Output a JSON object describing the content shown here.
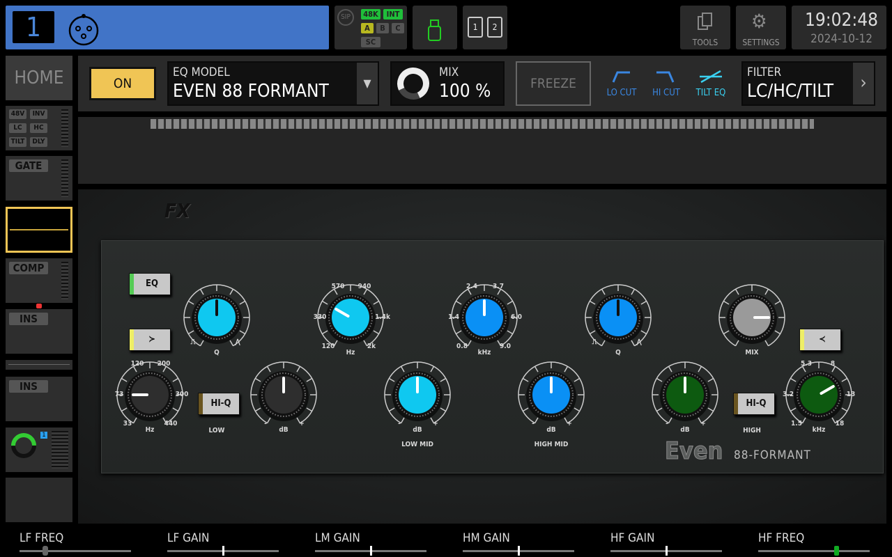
{
  "header": {
    "channel_number": "1",
    "channel_icon": "xlr-input-icon",
    "sip": "SIP",
    "rate": "48K",
    "clock": "INT",
    "buses": [
      "A",
      "B",
      "C"
    ],
    "sc": "SC",
    "usb_icon": "usb-icon",
    "sd_slots": [
      "1",
      "2"
    ],
    "tools": "TOOLS",
    "settings": "SETTINGS",
    "time": "19:02:48",
    "date": "2024-10-12"
  },
  "sidebar": {
    "home": "HOME",
    "input_tags": [
      "48V",
      "INV",
      "LC",
      "HC",
      "TILT",
      "DLY"
    ],
    "gate": "GATE",
    "comp": "COMP",
    "ins1": "INS",
    "ins2": "INS",
    "send_number": "1"
  },
  "toolbar": {
    "on": "ON",
    "eq_model_label": "EQ MODEL",
    "eq_model": "EVEN 88 FORMANT",
    "mix_label": "MIX",
    "mix_value": "100 %",
    "mix_level": 1.0,
    "freeze": "FREEZE",
    "lo_cut": "LO CUT",
    "hi_cut": "HI CUT",
    "tilt_eq": "TILT EQ",
    "filter_label": "FILTER",
    "filter_value": "LC/HC/TILT"
  },
  "plugin": {
    "logo": "FX",
    "brand": "Even",
    "model": "88-FORMANT",
    "eq_button": "EQ",
    "hiq": "HI-Q",
    "low": "LOW",
    "low_mid": "LOW MID",
    "high_mid": "HIGH MID",
    "high": "HIGH",
    "mix": "MIX",
    "knobs": [
      {
        "id": "lm-q",
        "color": "#0fc8f0",
        "position": 0.5,
        "pointer": "#111",
        "unit": "Q",
        "scale": [],
        "q": true
      },
      {
        "id": "lm-freq",
        "color": "#0fc8f0",
        "position": 0.3,
        "pointer": "#fff",
        "unit": "Hz",
        "scale": [
          "570",
          "940",
          "330",
          "1.4k",
          "120",
          "2k"
        ]
      },
      {
        "id": "hm-freq",
        "color": "#0a90f5",
        "position": 0.5,
        "pointer": "#fff",
        "unit": "kHz",
        "scale": [
          "2.4",
          "3.7",
          "1.4",
          "6.0",
          "0.8",
          "9.0"
        ]
      },
      {
        "id": "hm-q",
        "color": "#0a90f5",
        "position": 0.5,
        "pointer": "#111",
        "unit": "Q",
        "scale": [],
        "q": true
      },
      {
        "id": "mix",
        "color": "#9a9a9a",
        "position": 0.8,
        "pointer": "#fff",
        "unit": "",
        "scale": []
      },
      {
        "id": "lf-freq",
        "color": "#2e2e2e",
        "position": 0.2,
        "pointer": "#fff",
        "unit": "Hz",
        "scale": [
          "120",
          "200",
          "73",
          "300",
          "33",
          "440"
        ]
      },
      {
        "id": "lf-gain",
        "color": "#2e2e2e",
        "position": 0.5,
        "pointer": "#fff",
        "unit": "dB",
        "scale": [],
        "pm": true
      },
      {
        "id": "lm-gain",
        "color": "#0fc8f0",
        "position": 0.5,
        "pointer": "#fff",
        "unit": "dB",
        "scale": [],
        "pm": true
      },
      {
        "id": "hm-gain",
        "color": "#0a90f5",
        "position": 0.5,
        "pointer": "#fff",
        "unit": "dB",
        "scale": [],
        "pm": true
      },
      {
        "id": "hf-gain",
        "color": "#0d5a10",
        "position": 0.5,
        "pointer": "#fff",
        "unit": "dB",
        "scale": [],
        "pm": true
      },
      {
        "id": "hf-freq",
        "color": "#0d5a10",
        "position": 0.7,
        "pointer": "#fff",
        "unit": "kHz",
        "scale": [
          "5.3",
          "8",
          "3.2",
          "13",
          "1.5",
          "18"
        ]
      }
    ]
  },
  "params": [
    {
      "label": "LF FREQ",
      "value": 0.21
    },
    {
      "label": "LF GAIN",
      "value": 0.5
    },
    {
      "label": "LM GAIN",
      "value": 0.5
    },
    {
      "label": "HM GAIN",
      "value": 0.5
    },
    {
      "label": "HF GAIN",
      "value": 0.5
    },
    {
      "label": "HF FREQ",
      "value": 0.69
    }
  ],
  "colors": {
    "channel": "#4174c7",
    "on": "#f0c555",
    "accent_blue": "#3a86e0",
    "tilt": "#3ad0f0"
  }
}
